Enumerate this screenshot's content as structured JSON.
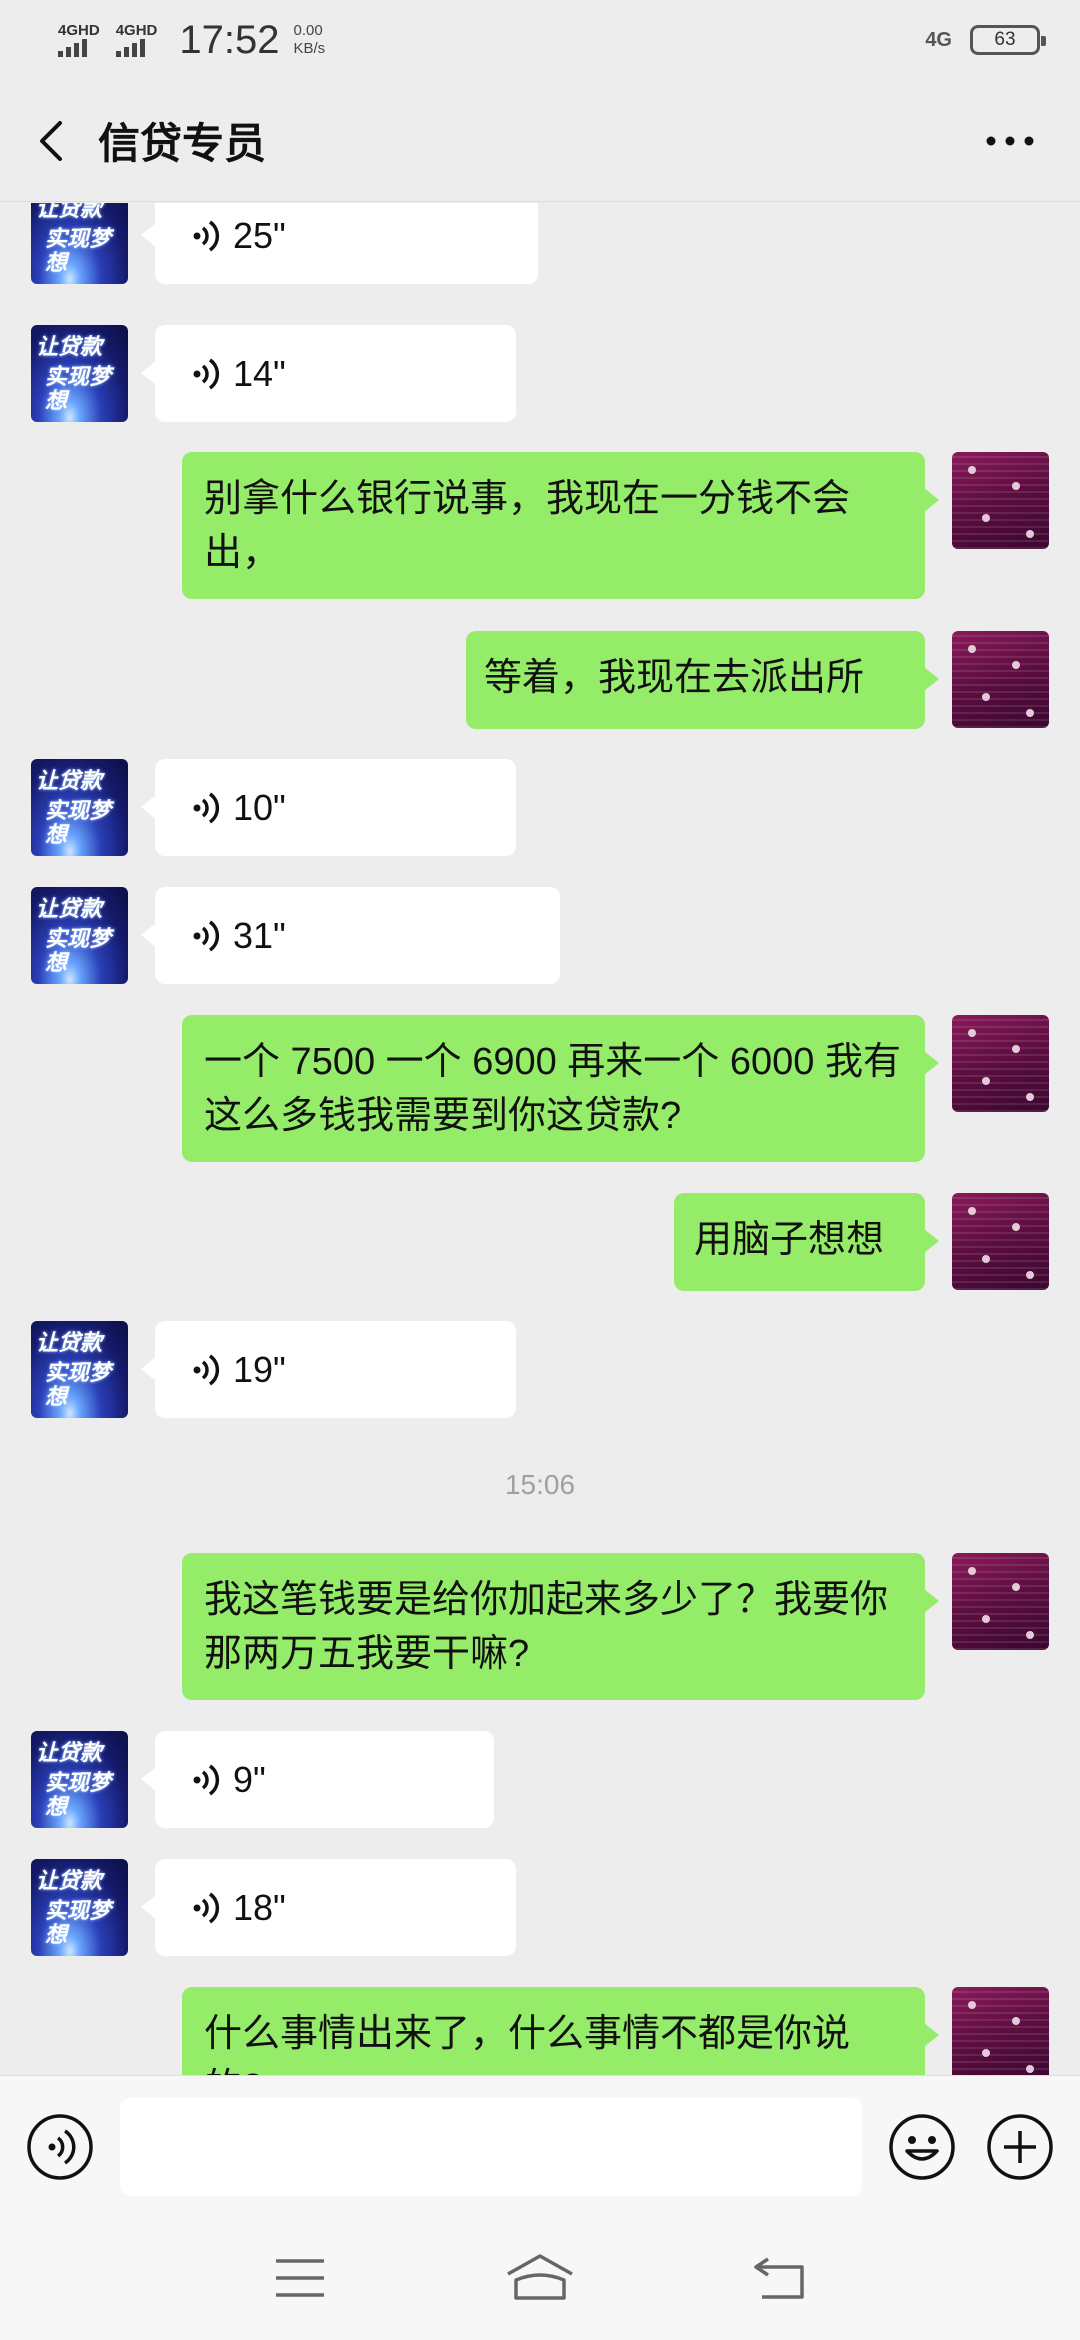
{
  "status_bar": {
    "sim1": "4GHD",
    "sim2": "4GHD",
    "time": "17:52",
    "net_speed": "0.00",
    "net_unit": "KB/s",
    "network": "4G",
    "battery": "63"
  },
  "header": {
    "title": "信贷专员",
    "back_icon": "chevron-left-icon",
    "more_icon": "more-dots-icon"
  },
  "avatars": {
    "bot_lines": [
      "让贷款",
      "实现梦想"
    ]
  },
  "messages": [
    {
      "type": "voice",
      "side": "in",
      "duration": "25\""
    },
    {
      "type": "voice",
      "side": "in",
      "duration": "14\""
    },
    {
      "type": "text",
      "side": "out",
      "text": "别拿什么银行说事，我现在一分钱不会出，"
    },
    {
      "type": "text",
      "side": "out",
      "text": "等着，我现在去派出所"
    },
    {
      "type": "voice",
      "side": "in",
      "duration": "10\""
    },
    {
      "type": "voice",
      "side": "in",
      "duration": "31\""
    },
    {
      "type": "text",
      "side": "out",
      "text": "一个 7500 一个 6900 再来一个 6000 我有这么多钱我需要到你这贷款?"
    },
    {
      "type": "text",
      "side": "out",
      "text": "用脑子想想"
    },
    {
      "type": "voice",
      "side": "in",
      "duration": "19\""
    },
    {
      "type": "time",
      "text": "15:06"
    },
    {
      "type": "text",
      "side": "out",
      "text": "我这笔钱要是给你加起来多少了？我要你那两万五我要干嘛?"
    },
    {
      "type": "voice",
      "side": "in",
      "duration": "9\""
    },
    {
      "type": "voice",
      "side": "in",
      "duration": "18\""
    },
    {
      "type": "text",
      "side": "out",
      "text": "什么事情出来了，什么事情不都是你说的?"
    }
  ],
  "input_bar": {
    "voice_icon": "voice-input-icon",
    "input_value": "",
    "emoji_icon": "emoji-icon",
    "plus_icon": "plus-icon"
  },
  "nav_bar": {
    "menu_icon": "menu-icon",
    "home_icon": "home-icon",
    "back_icon": "back-arrow-icon"
  }
}
